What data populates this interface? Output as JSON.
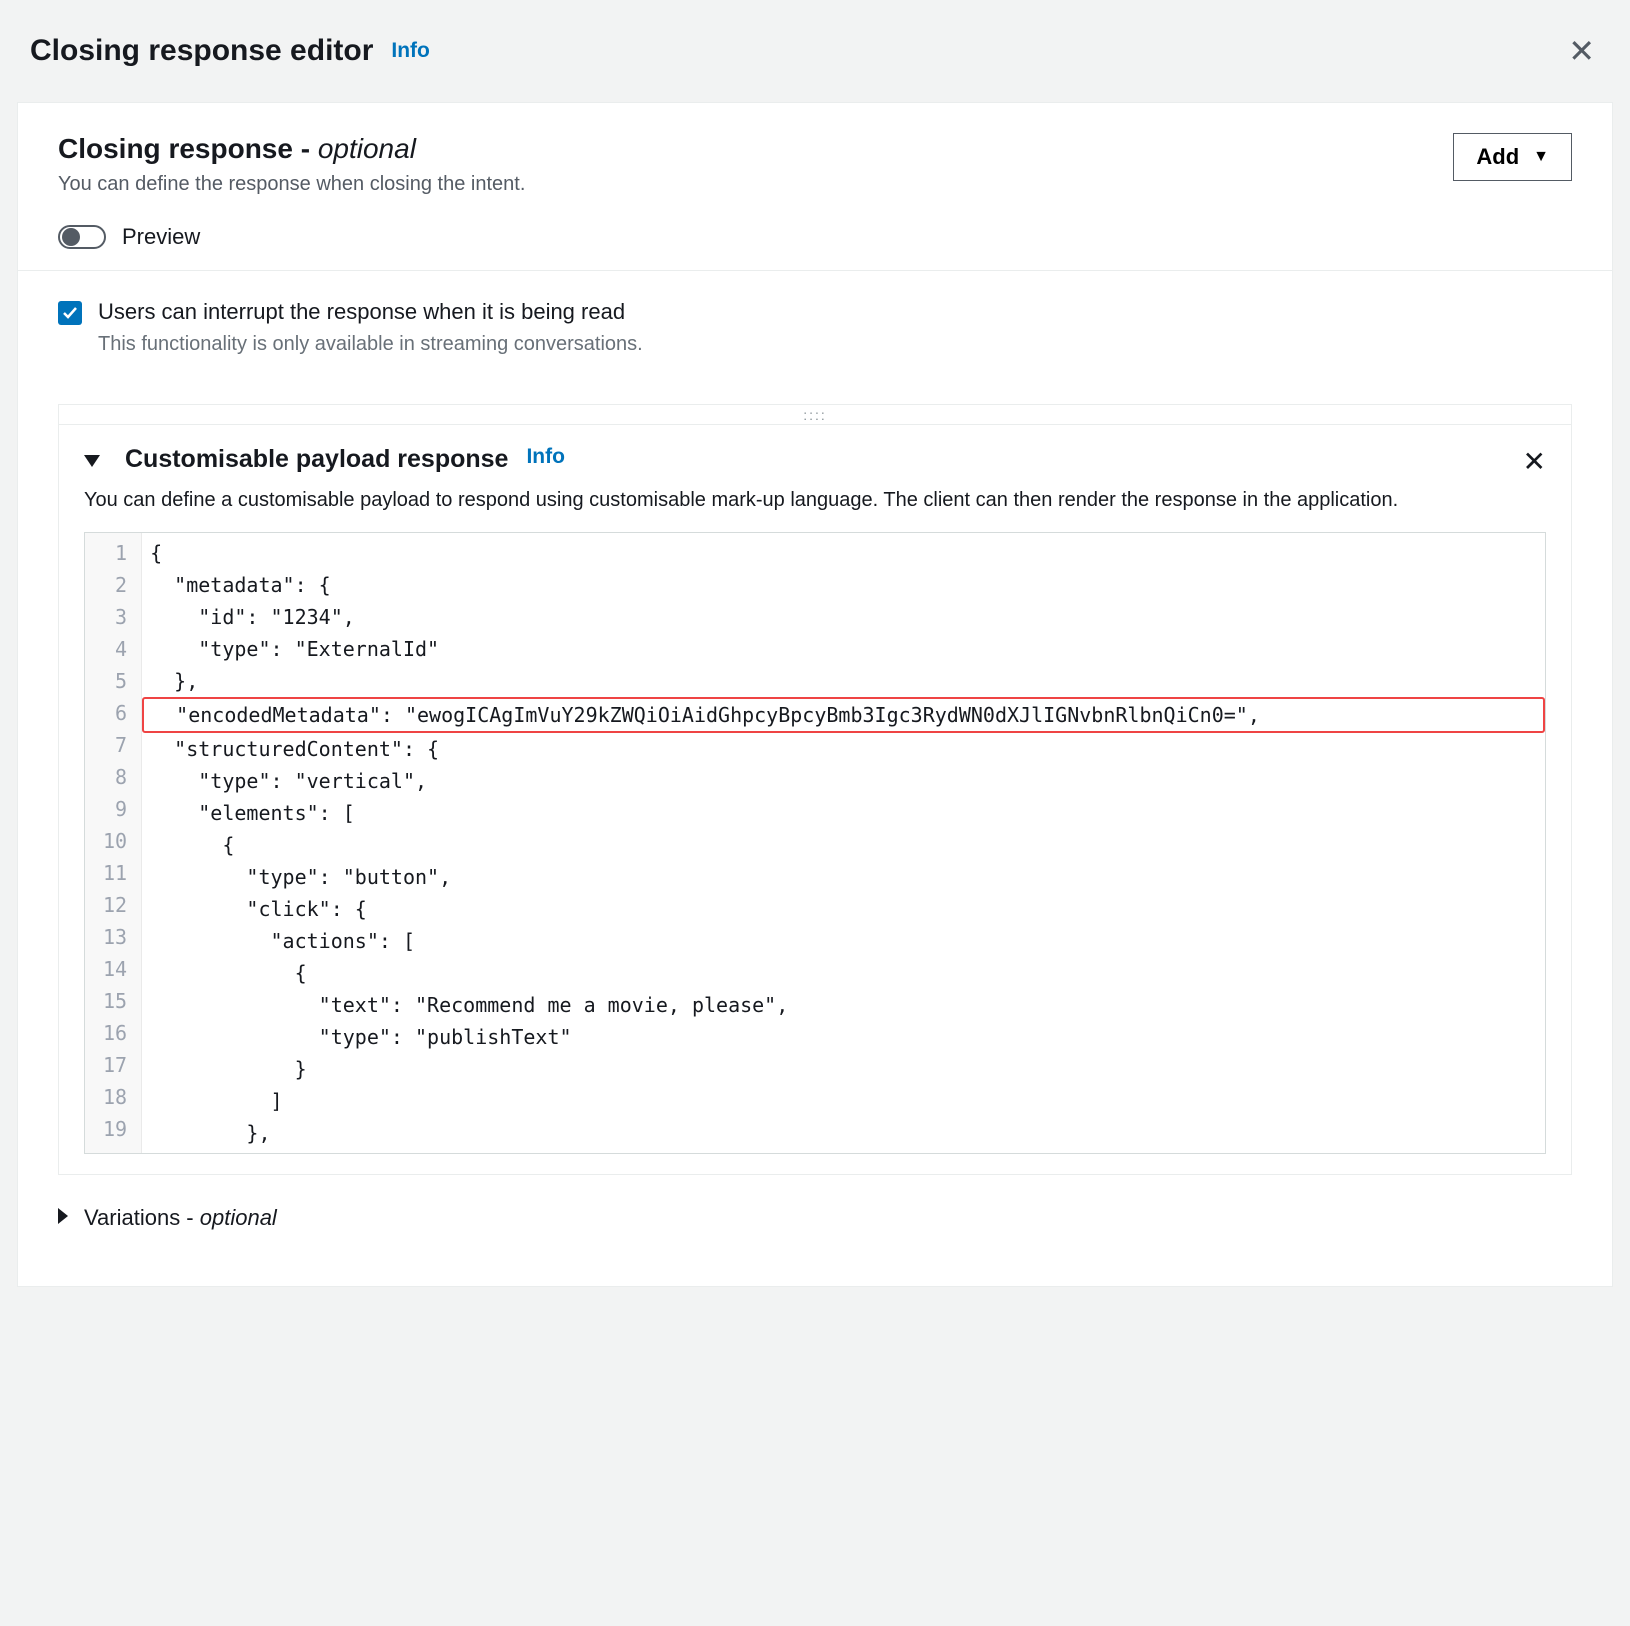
{
  "modal": {
    "title": "Closing response editor",
    "info": "Info"
  },
  "panel": {
    "title_prefix": "Closing response - ",
    "title_optional": "optional",
    "description": "You can define the response when closing the intent.",
    "add_button": "Add",
    "preview_label": "Preview"
  },
  "interrupt": {
    "label": "Users can interrupt the response when it is being read",
    "description": "This functionality is only available in streaming conversations."
  },
  "payload": {
    "title": "Customisable payload response",
    "info": "Info",
    "description": "You can define a customisable payload to respond using customisable mark-up language. The client can then render the response in the application."
  },
  "code": {
    "lines": [
      "{",
      "  \"metadata\": {",
      "    \"id\": \"1234\",",
      "    \"type\": \"ExternalId\"",
      "  },",
      "  \"encodedMetadata\": \"ewogICAgImVuY29kZWQiOiAidGhpcyBpcyBmb3Igc3RydWN0dXJlIGNvbnRlbnQiCn0=\",",
      "  \"structuredContent\": {",
      "    \"type\": \"vertical\",",
      "    \"elements\": [",
      "      {",
      "        \"type\": \"button\",",
      "        \"click\": {",
      "          \"actions\": [",
      "            {",
      "              \"text\": \"Recommend me a movie, please\",",
      "              \"type\": \"publishText\"",
      "            }",
      "          ]",
      "        },"
    ],
    "highlight_index": 5
  },
  "variations": {
    "label_prefix": "Variations - ",
    "label_optional": "optional"
  }
}
